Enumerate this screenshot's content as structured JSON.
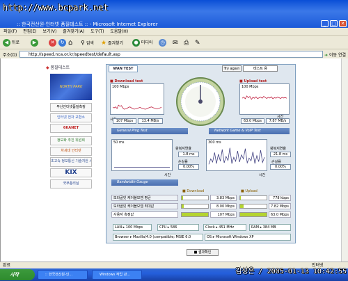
{
  "watermark": "http://www.bcpark.net",
  "window": {
    "title": ":: 한국전산원-인터넷 품질테스트 :: - Microsoft Internet Explorer"
  },
  "menu": [
    "파일(F)",
    "편집(E)",
    "보기(V)",
    "즐겨찾기(A)",
    "도구(T)",
    "도움말(H)"
  ],
  "nav": {
    "back": "뒤로",
    "search": "검색",
    "favorites": "즐겨찾기",
    "media": "미디어"
  },
  "address": {
    "label": "주소(D)",
    "url": "http://speed.nca.or.kr/speedtest/default.asp",
    "go": "이동",
    "links": "연결"
  },
  "sidebar": {
    "title": "품질테스트",
    "banner": "NORTH PARK",
    "links": [
      "부산인터넷품질측정",
      "인터넷 전자 교환소",
      "6KANET",
      "정보화 추진 위원회",
      "차세대 인터넷",
      "초고속 정보통신 기술지원 시스템",
      "KIX",
      "국무총리실"
    ]
  },
  "test": {
    "tab": "WAN TEST",
    "try_again": "Try again",
    "server": "테스트 용",
    "download": {
      "title": "Download test",
      "max": "100 Mbps",
      "y_label": "Speed(Mbps)",
      "x_label": "시간",
      "current": "107 Mbps",
      "avg": "13.4 MB/s",
      "series": [
        20,
        18,
        22,
        15,
        30,
        25,
        28,
        18,
        12,
        14,
        16,
        20,
        22,
        18,
        15,
        12,
        14,
        16,
        18,
        20,
        17,
        15,
        13,
        12,
        15,
        18,
        20,
        22,
        19,
        17,
        15,
        13,
        16,
        18,
        20
      ]
    },
    "upload": {
      "title": "Upload test",
      "max": "100 Mbps",
      "y_label": "Speed(Mbps)",
      "x_label": "시간",
      "current": "63.0 Mbps",
      "avg": "7.87 MB/s",
      "series": [
        60,
        65,
        58,
        70,
        62,
        68,
        55,
        64,
        60,
        66,
        58,
        62,
        65,
        60,
        68,
        63,
        59,
        64,
        61,
        66,
        58,
        63,
        60,
        65,
        62,
        59,
        64,
        61,
        63,
        60
      ]
    },
    "ping": {
      "title": "General Ping Test",
      "max": "50 ms",
      "y_label": "RTT(ms)",
      "x_label": "시간",
      "rtt_label": "왕복지연율",
      "rtt": "1.8 ms",
      "loss_label": "손실률",
      "loss": "0.00%",
      "series": [
        2,
        2,
        2,
        2,
        2,
        2,
        2,
        2,
        2,
        2,
        2,
        2,
        2,
        2,
        2,
        2,
        2,
        2,
        2,
        2,
        2,
        2,
        2,
        2,
        2,
        2,
        2,
        2,
        2,
        2
      ]
    },
    "voip": {
      "title": "Network Game & VoIP Test",
      "max": "300 ms",
      "y_label": "RTT(ms)",
      "x_label": "시간",
      "rtt_label": "왕복지연율",
      "rtt": "21.8 ms",
      "loss_label": "손실률",
      "loss": "0.00%",
      "series": [
        50,
        120,
        80,
        200,
        60,
        180,
        90,
        240,
        70,
        150,
        100,
        260,
        60,
        140,
        90,
        220,
        80,
        170,
        120,
        250,
        70,
        130,
        95,
        210,
        60,
        160,
        85,
        230,
        75,
        140
      ]
    },
    "bandwidth": {
      "title": "Bandwidth Gauge",
      "download_header": "Download",
      "upload_header": "Upload",
      "rows": [
        {
          "label": "보라골넷 케이블모뎀 평균",
          "down": "3.83 Mbps",
          "down_pct": 4,
          "up": "778 kbps",
          "up_pct": 1
        },
        {
          "label": "보라골넷 케이블모뎀 최대값",
          "down": "8.00 Mbps",
          "down_pct": 8,
          "up": "7.82 Mbps",
          "up_pct": 12
        },
        {
          "label": "사용자 측정값",
          "down": "107 Mbps",
          "down_pct": 100,
          "up": "63.0 Mbps",
          "up_pct": 100
        }
      ]
    },
    "sysinfo": {
      "lan_label": "LAN",
      "lan": "100 Mbps",
      "cpu_label": "CPU",
      "cpu": "586",
      "clock_label": "Clock",
      "clock": "451 MHz",
      "ram_label": "RAM",
      "ram": "384 MB",
      "browser_label": "Browser",
      "browser": "Mozilla/4.0 (compatible; MSIE 6.0",
      "os_label": "OS",
      "os": "Microsoft Windows XP"
    },
    "result_button": "결과확인"
  },
  "status": {
    "text": "완료",
    "zone": "인터넷"
  },
  "taskbar": {
    "start": "시작",
    "tasks": [
      ":: 한국전산원-인...",
      "Windows 작업 관..."
    ]
  },
  "clock": "김성은 / 2005-01-13 10:42:55"
}
